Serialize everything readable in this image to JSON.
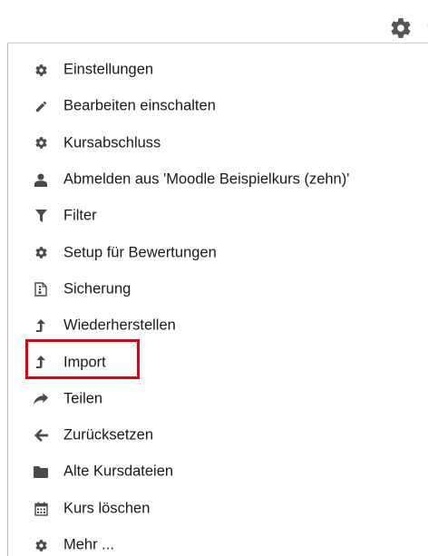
{
  "menu": {
    "items": [
      {
        "label": "Einstellungen",
        "icon": "gear-icon"
      },
      {
        "label": "Bearbeiten einschalten",
        "icon": "pencil-icon"
      },
      {
        "label": "Kursabschluss",
        "icon": "gear-icon"
      },
      {
        "label": "Abmelden aus 'Moodle Beispielkurs (zehn)'",
        "icon": "user-icon"
      },
      {
        "label": "Filter",
        "icon": "filter-icon"
      },
      {
        "label": "Setup für Bewertungen",
        "icon": "gear-icon"
      },
      {
        "label": "Sicherung",
        "icon": "backup-file-icon"
      },
      {
        "label": "Wiederherstellen",
        "icon": "level-up-icon"
      },
      {
        "label": "Import",
        "icon": "level-up-icon"
      },
      {
        "label": "Teilen",
        "icon": "share-icon"
      },
      {
        "label": "Zurücksetzen",
        "icon": "arrow-left-icon"
      },
      {
        "label": "Alte Kursdateien",
        "icon": "folder-icon"
      },
      {
        "label": "Kurs löschen",
        "icon": "calendar-icon"
      },
      {
        "label": "Mehr ...",
        "icon": "gear-icon"
      }
    ]
  },
  "header": {
    "action_icon": "gear-icon",
    "dropdown_icon": "chevron-down-icon"
  },
  "colors": {
    "icon": "#4a4a4a",
    "text": "#1a1a1a",
    "highlight": "#e3000f"
  }
}
